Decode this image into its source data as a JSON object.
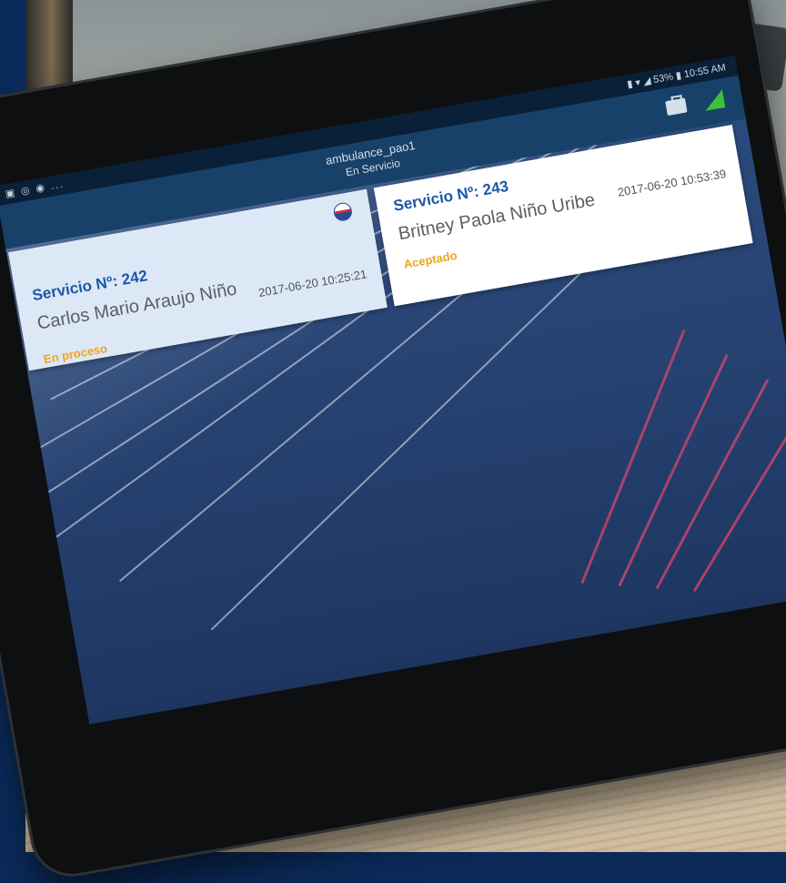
{
  "status_bar": {
    "left_icons": "▣ ◎ ◉ ...",
    "right_info": "▮ ▾ ◢ 53% ▮ 10:55 AM"
  },
  "app_bar": {
    "title": "ambulance_pao1",
    "subtitle": "En Servicio",
    "icons": [
      "menu-icon",
      "briefcase-icon",
      "signal-icon"
    ]
  },
  "services": [
    {
      "number_label": "Servicio Nº: 242",
      "name": "Carlos Mario Araujo Niño",
      "datetime": "2017-06-20 10:25:21",
      "status": "En proceso",
      "icon": "ambulance-icon"
    },
    {
      "number_label": "Servicio Nº: 243",
      "name": "Britney Paola Niño Uribe",
      "datetime": "2017-06-20 10:53:39",
      "status": "Aceptado"
    }
  ],
  "colors": {
    "app_bar": "#174169",
    "status_bar": "#0a2039",
    "number_text": "#1d57a7",
    "status_text": "#f0a41c",
    "card_active_bg": "#dde8f6",
    "card_bg": "#ffffff",
    "signal": "#3fbf3a"
  }
}
